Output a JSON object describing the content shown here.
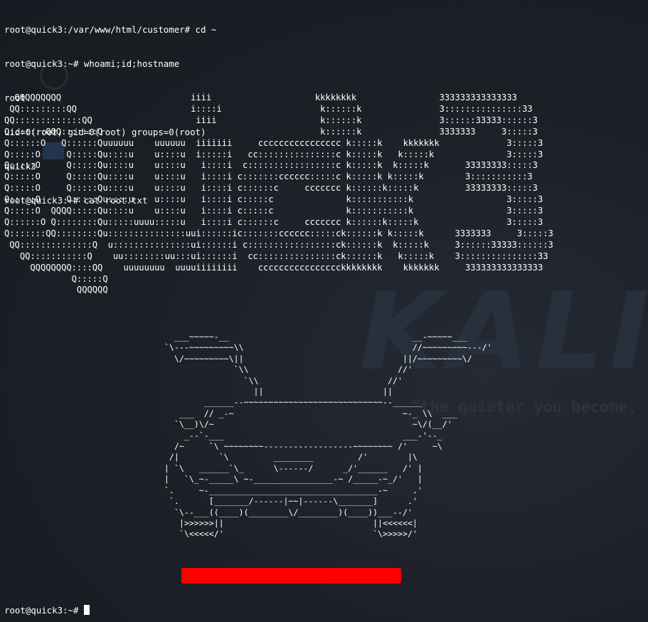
{
  "session": {
    "lines": [
      "root@quick3:/var/www/html/customer# cd ~",
      "root@quick3:~# whoami;id;hostname",
      "root",
      "uid=0(root) gid=0(root) groups=0(root)",
      "quick3",
      "root@quick3:~# cat root.txt"
    ]
  },
  "banner_art": "  QQQQQQQQQ                         iiii                    kkkkkkkk                333333333333333\n QQ:::::::::QQ                      i::::i                   k::::::k               3:::::::::::::::33\nQQ:::::::::::::QQ                    iiii                    k::::::k               3::::::33333::::::3\nQ:::::::QQQ:::::::Q                                          k::::::k               3333333     3:::::3\nQ::::::O   Q::::::Quuuuuu    uuuuuu  iiiiiii     cccccccccccccccc k:::::k    kkkkkkk             3:::::3\nQ:::::O     Q:::::Qu::::u    u::::u  i:::::i   cc:::::::::::::::c k:::::k   k:::::k              3:::::3\nQ:::::O     Q:::::Qu::::u    u::::u   i::::i  c:::::::::::::::::c k:::::k  k:::::k       33333333:::::3\nQ:::::O     Q:::::Qu::::u    u::::u   i::::i c:::::::cccccc:::::c k:::::k k:::::k        3:::::::::::3\nQ:::::O     Q:::::Qu::::u    u::::u   i::::i c::::::c     ccccccc k::::::k:::::k         33333333:::::3\nQ:::::O     Q:::::Qu::::u    u::::u   i::::i c:::::c              k:::::::::::k                  3:::::3\nQ:::::O  QQQQ:::::Qu::::u    u::::u   i::::i c:::::c              k:::::::::::k                  3:::::3\nQ::::::O Q::::::::Qu:::::uuuu:::::u   i::::i c::::::c     ccccccc k::::::k:::::k                 3:::::3\nQ:::::::QQ::::::::Qu:::::::::::::::uui::::::ic:::::::cccccc:::::ck::::::k k:::::k      3333333     3:::::3\n QQ::::::::::::::Q  u:::::::::::::::ui::::::i c:::::::::::::::::ck::::::k  k:::::k     3::::::33333::::::3\n   QQ:::::::::::Q    uu::::::::uu:::ui::::::i  cc:::::::::::::::ck::::::k   k:::::k    3:::::::::::::::33\n     QQQQQQQQ::::QQ    uuuuuuuu  uuuuiiiiiiii    cccccccccccccccckkkkkkkk    kkkkkkk     333333333333333\n             Q:::::Q\n              QQQQQQ",
  "car_art": "      ___~~~~~-__                                     __-~~~~~___\n    `\\---~~~~~~~~~\\\\                                  //~~~~~~~~~---/'\n      \\/~~~~~~~~~\\||                                ||/~~~~~~~~~\\/\n                  `\\\\                              //'\n                    `\\\\                          //'\n                      ||                        ||\n            ______--~~~~~~~~~~~~~~~~~~~~~~~~~~~~--______\n       ___  // _-~                                  ~-_ \\\\  ___\n      `\\__)\\/~                                        ~\\/(__/'\n        _--`-___                                    ___-'--_\n      /~     `\\ ~~~~~~~~------------------~~~~~~~~ /'     ~\\\n     /|        `\\         ________         /'        |\\\n    | `\\   ______`\\_      \\------/      _/'______   /' |\n    |   `\\_~-_____\\ ~-________________-~ /_____-~_/'   |\n    `.     ~-__________________________________-~     .'\n     `.      [_______/------|~~|------\\_______]      .'\n      `\\--___((____)(________\\/________)(____))___--/'\n       |>>>>>>||                              ||<<<<<<|\n       `\\<<<<</'                              `\\>>>>>/'",
  "prompt": {
    "text": "root@quick3:~# ",
    "cursor": "block"
  },
  "wallpaper": {
    "brand": "KALI",
    "tagline": "\"the quieter you become,"
  },
  "colors": {
    "background": "#1c1f26",
    "text": "#ffffff",
    "red_bar": "#ff0000"
  }
}
